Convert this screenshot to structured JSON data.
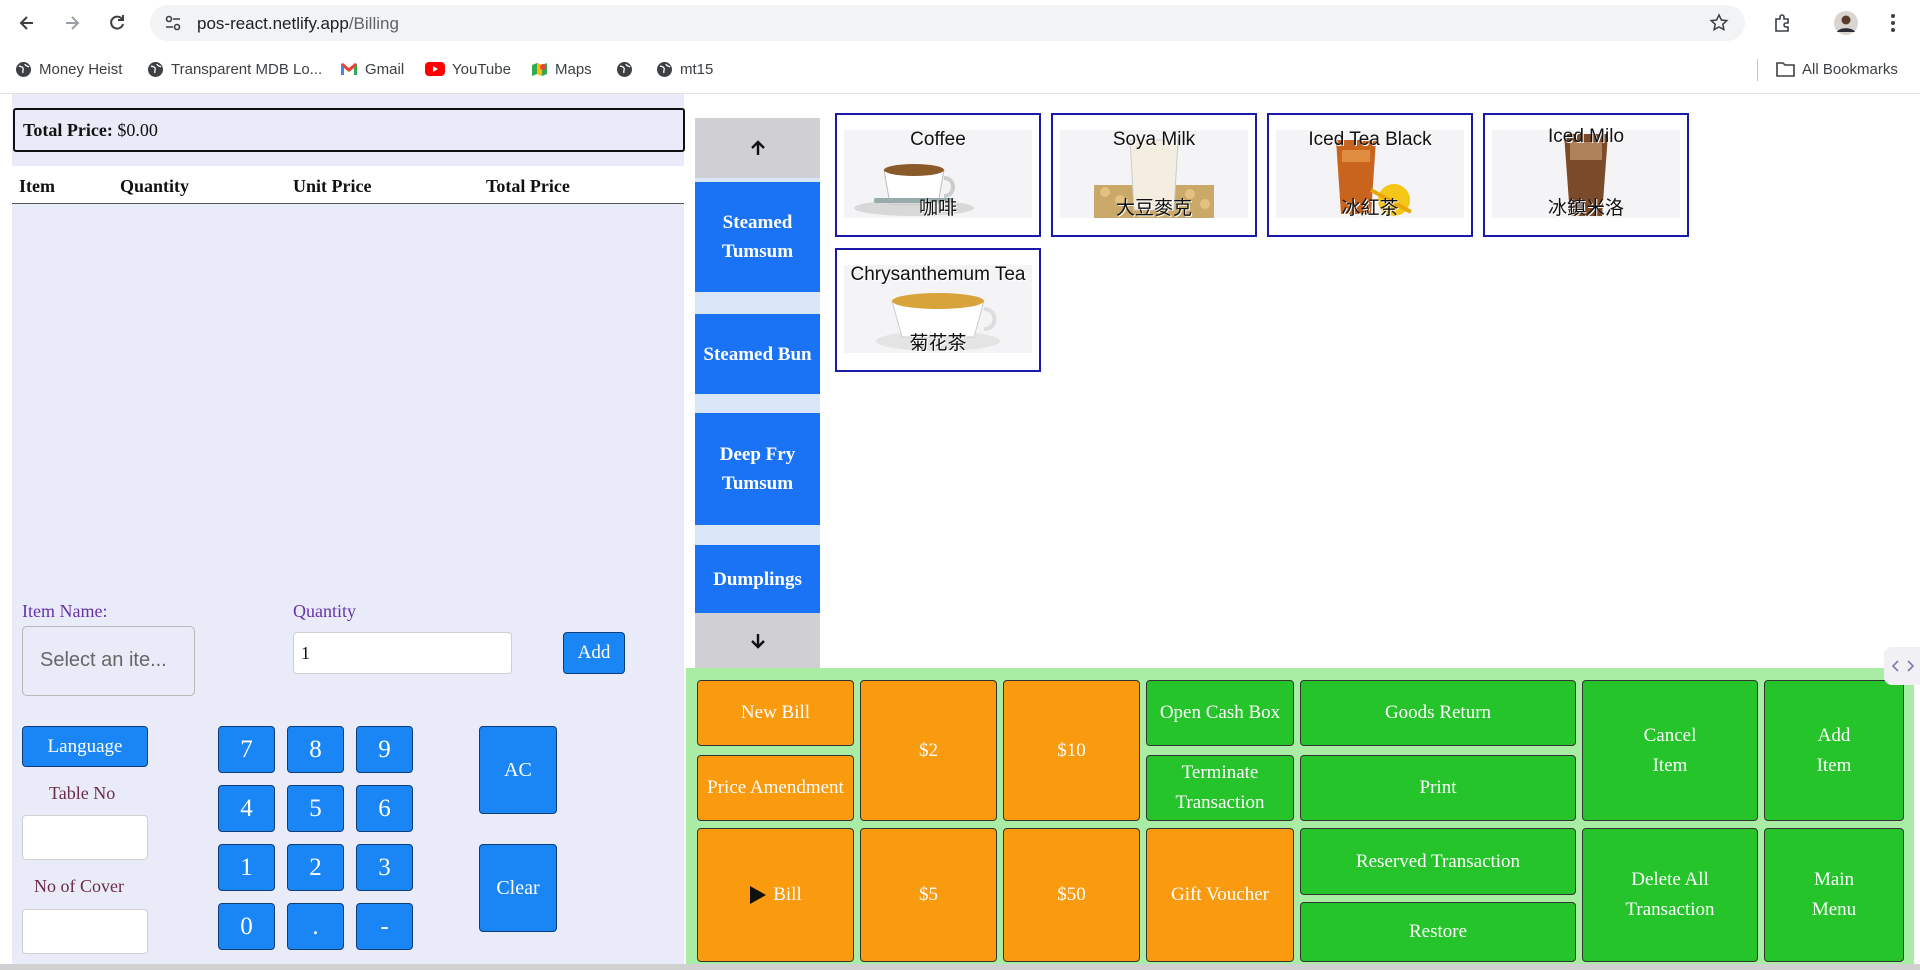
{
  "browser": {
    "url_host": "pos-react.netlify.app",
    "url_path": "/Billing",
    "bookmarks": [
      "Money Heist",
      "Transparent MDB Lo...",
      "Gmail",
      "YouTube",
      "Maps",
      "",
      "mt15"
    ],
    "all_bookmarks": "All Bookmarks"
  },
  "order": {
    "total_label": "Total Price:",
    "total_value": "$0.00",
    "columns": [
      "Item",
      "Quantity",
      "Unit Price",
      "Total Price"
    ],
    "rows": []
  },
  "entry": {
    "item_name_label": "Item Name:",
    "item_placeholder": "Select an ite...",
    "quantity_label": "Quantity",
    "quantity_value": "1",
    "add_label": "Add"
  },
  "settings": {
    "language_label": "Language",
    "table_no_label": "Table No",
    "table_no_value": "",
    "cover_label": "No of Cover",
    "cover_value": ""
  },
  "keypad": {
    "keys": [
      "7",
      "8",
      "9",
      "4",
      "5",
      "6",
      "1",
      "2",
      "3",
      "0",
      ".",
      "-"
    ],
    "ac_label": "AC",
    "clear_label": "Clear"
  },
  "categories": [
    "Steamed Tumsum",
    "Steamed Bun",
    "Deep Fry Tumsum",
    "Dumplings"
  ],
  "products": [
    {
      "name": "Coffee",
      "cn": "咖啡"
    },
    {
      "name": "Soya Milk",
      "cn": "大豆麥克"
    },
    {
      "name": "Iced Tea Black",
      "cn": "冰紅茶"
    },
    {
      "name": "Iced Milo",
      "cn": "冰鎮米洛"
    },
    {
      "name": "Chrysanthemum Tea",
      "cn": "菊花茶"
    }
  ],
  "actions": {
    "new_bill": "New Bill",
    "price_amendment": "Price Amendment",
    "bill": "Bill",
    "two": "$2",
    "five": "$5",
    "ten": "$10",
    "fifty": "$50",
    "open_cash_box": "Open Cash Box",
    "terminate": "Terminate Transaction",
    "gift_voucher": "Gift Voucher",
    "goods_return": "Goods Return",
    "print": "Print",
    "reserved": "Reserved Transaction",
    "restore": "Restore",
    "cancel_item": "Cancel Item",
    "delete_all": "Delete All Transaction",
    "add_item": "Add Item",
    "main_menu": "Main Menu"
  },
  "colors": {
    "primary_blue": "#1a86f5",
    "category_blue": "#1a73f5",
    "orange": "#fa9a0e",
    "green": "#26c42b",
    "panel_green": "#a8eda3"
  }
}
